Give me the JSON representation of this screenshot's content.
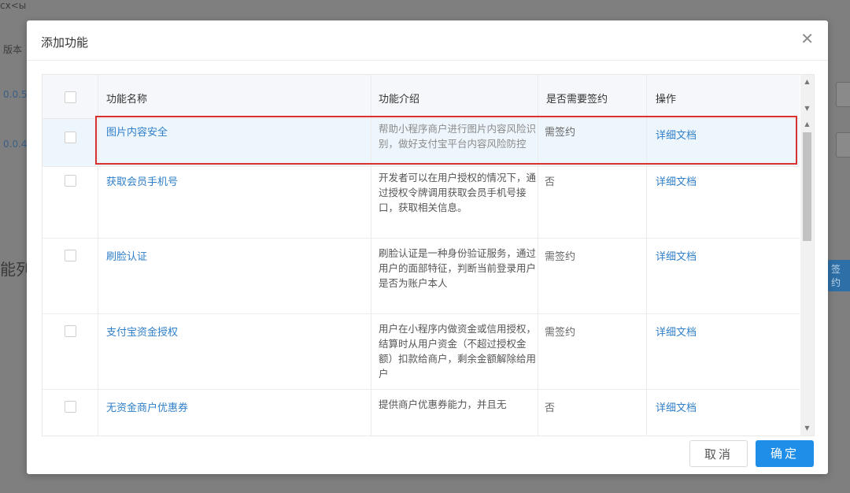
{
  "background": {
    "frag_top": "сх<ы",
    "label_version": "版本",
    "version_1": "0.0.5",
    "version_2": "0.0.4",
    "section_title": "能列",
    "tag": "签约"
  },
  "modal": {
    "title": "添加功能",
    "table": {
      "headers": [
        "功能名称",
        "功能介绍",
        "是否需要签约",
        "操作"
      ],
      "rows": [
        {
          "name": "图片内容安全",
          "desc": "帮助小程序商户进行图片内容风险识别，做好支付宝平台内容风险防控",
          "sign": "需签约",
          "op": "详细文档"
        },
        {
          "name": "获取会员手机号",
          "desc": "开发者可以在用户授权的情况下，通过授权令牌调用获取会员手机号接口，获取相关信息。",
          "sign": "否",
          "op": "详细文档"
        },
        {
          "name": "刷脸认证",
          "desc": "刷脸认证是一种身份验证服务，通过用户的面部特征，判断当前登录用户是否为账户本人",
          "sign": "需签约",
          "op": "详细文档"
        },
        {
          "name": "支付宝资金授权",
          "desc": "用户在小程序内做资金或信用授权，结算时从用户资金（不超过授权金额）扣款给商户，剩余金额解除给用户",
          "sign": "需签约",
          "op": "详细文档"
        },
        {
          "name": "无资金商户优惠券",
          "desc": "提供商户优惠券能力，并且无",
          "sign": "否",
          "op": "详细文档"
        }
      ]
    },
    "buttons": {
      "cancel": "取消",
      "ok": "确定"
    }
  },
  "icons": {
    "close": "close-icon",
    "scroll_up": "arrow-up-icon",
    "scroll_down": "arrow-down-icon"
  },
  "colors": {
    "link": "#2f7fc9",
    "primary": "#1f8ee8",
    "highlight": "#d93030"
  }
}
